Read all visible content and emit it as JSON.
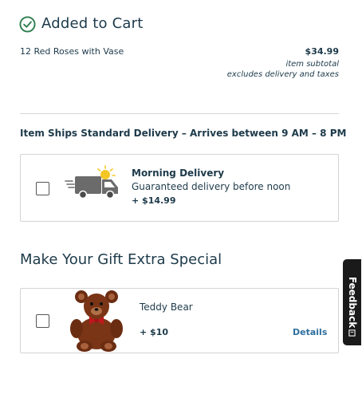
{
  "header": {
    "title": "Added to Cart"
  },
  "product": {
    "name": "12 Red Roses with Vase",
    "price": "$34.99",
    "subtotal_label": "item subtotal",
    "excludes_label": "excludes delivery and taxes"
  },
  "shipping": {
    "heading": "Item Ships Standard Delivery – Arrives between 9 AM – 8 PM",
    "option": {
      "title": "Morning Delivery",
      "description": "Guaranteed delivery before noon",
      "price": "+ $14.99",
      "checked": false
    }
  },
  "gift": {
    "heading": "Make Your Gift Extra Special",
    "item": {
      "name": "Teddy Bear",
      "price": "+ $10",
      "details_label": "Details",
      "checked": false
    }
  },
  "feedback": {
    "label": "Feedback"
  },
  "colors": {
    "text": "#1d3a4a",
    "check": "#2e7d4f",
    "link": "#2e6f9e",
    "border": "#d4d4d4",
    "feedback_bg": "#1a1a1a"
  },
  "icons": [
    "check-circle-icon",
    "delivery-truck-icon",
    "teddy-bear-image",
    "feedback-icon"
  ]
}
